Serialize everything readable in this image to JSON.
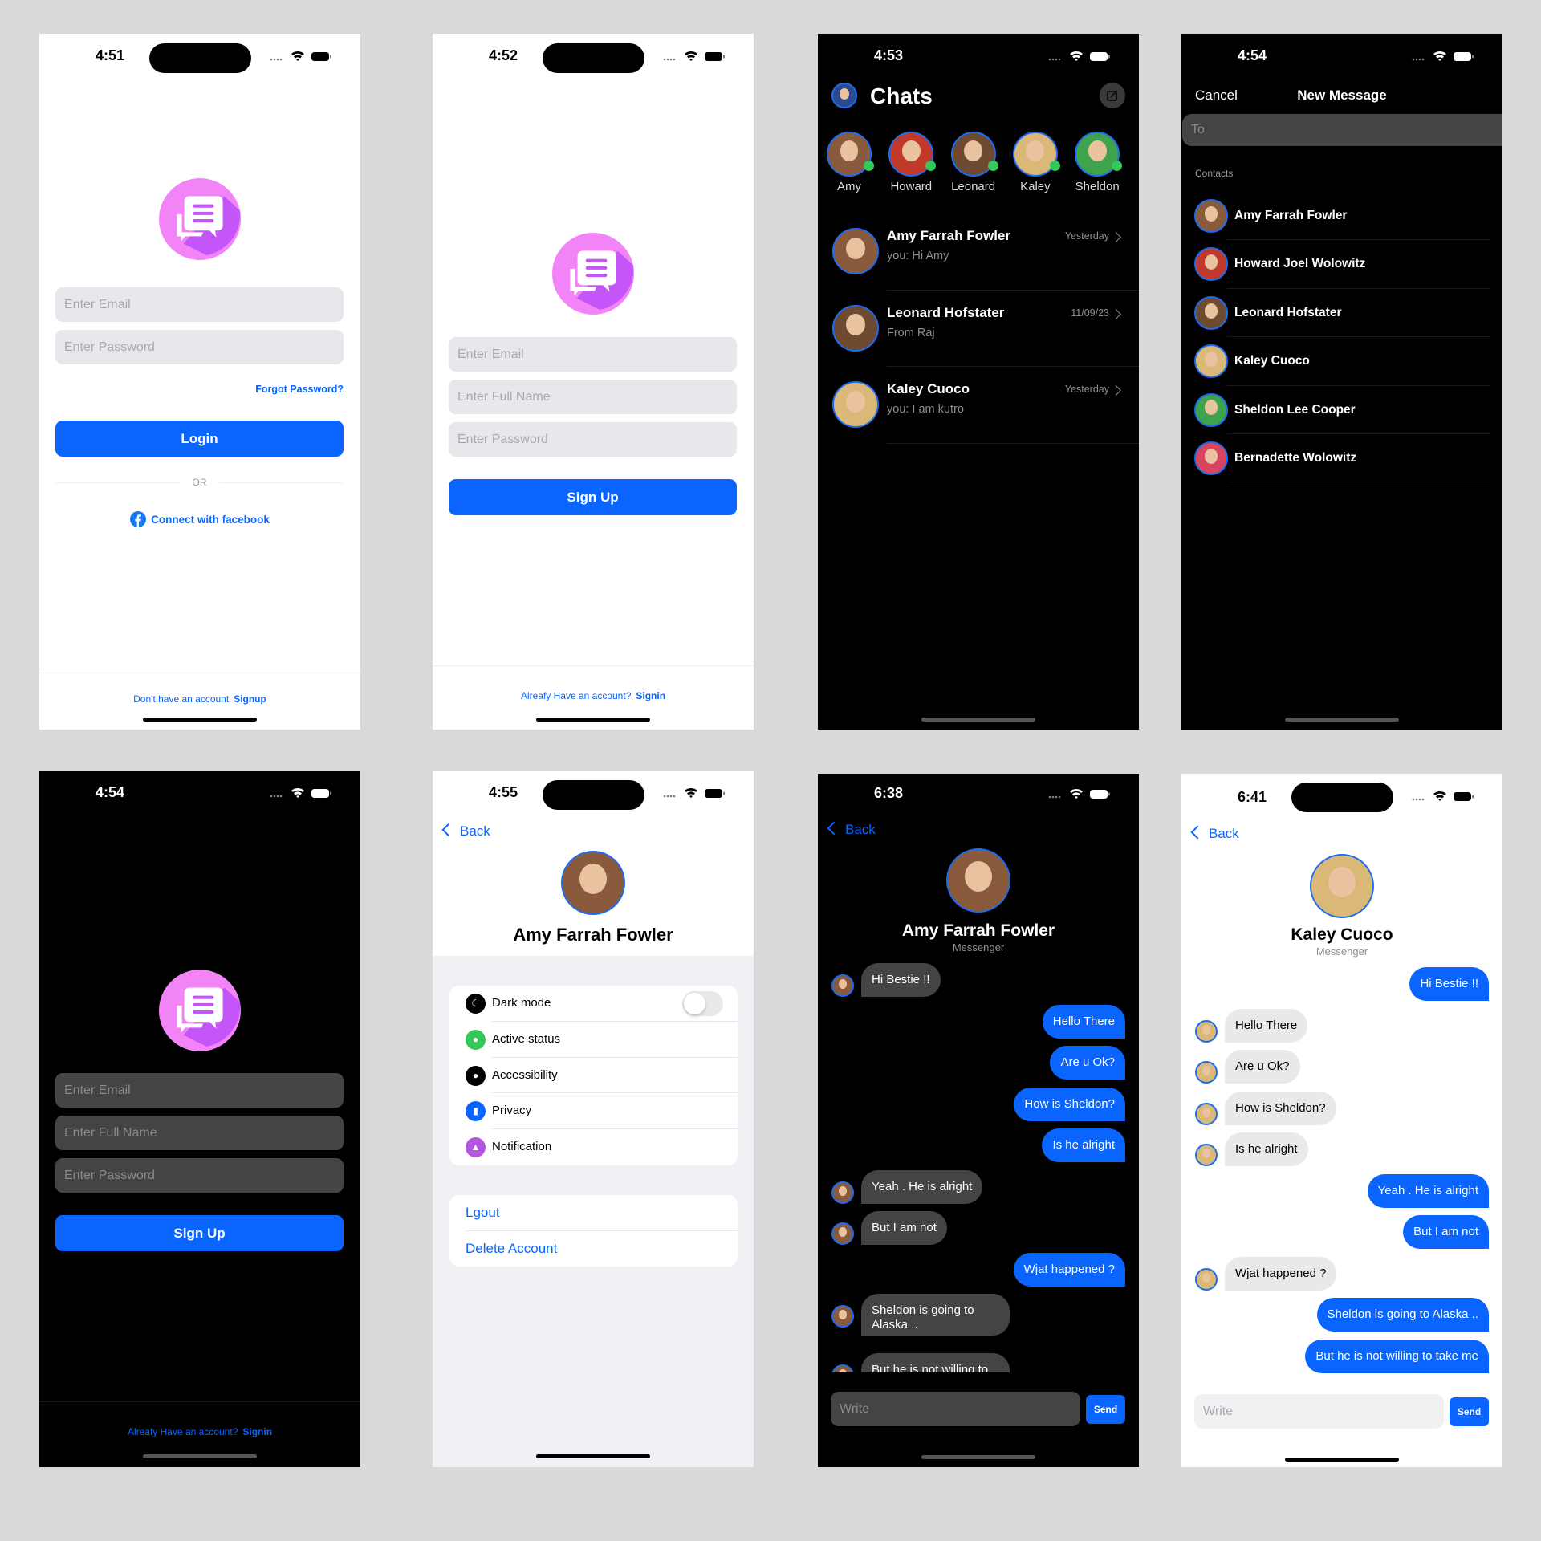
{
  "colors": {
    "accent": "#0a65ff",
    "online": "#34c759",
    "logo_pink": "#f384f8",
    "logo_purple": "#c455f9"
  },
  "login": {
    "time": "4:51",
    "email_placeholder": "Enter Email",
    "password_placeholder": "Enter Password",
    "forgot": "Forgot Password?",
    "login": "Login",
    "or": "OR",
    "facebook": "Connect with facebook",
    "footer_text": "Don't have an account",
    "footer_link": "Signup"
  },
  "signup_light": {
    "time": "4:52",
    "email_placeholder": "Enter Email",
    "fullname_placeholder": "Enter Full Name",
    "password_placeholder": "Enter Password",
    "signup": "Sign Up",
    "footer_text": "Alreafy Have an account?",
    "footer_link": "Signin"
  },
  "chats": {
    "time": "4:53",
    "title": "Chats",
    "stories": [
      {
        "name": "Amy",
        "color": "#8a5a3c",
        "online": true
      },
      {
        "name": "Howard",
        "color": "#c0392b",
        "online": true
      },
      {
        "name": "Leonard",
        "color": "#6e4a30",
        "online": true
      },
      {
        "name": "Kaley",
        "color": "#d9b878",
        "online": true
      },
      {
        "name": "Sheldon",
        "color": "#3fa34d",
        "online": true
      }
    ],
    "conversations": [
      {
        "name": "Amy Farrah Fowler",
        "preview": "you: Hi Amy",
        "date": "Yesterday",
        "color": "#8a5a3c"
      },
      {
        "name": "Leonard Hofstater",
        "preview": "From Raj",
        "date": "11/09/23",
        "color": "#6e4a30"
      },
      {
        "name": "Kaley Cuoco",
        "preview": "you: I am kutro",
        "date": "Yesterday",
        "color": "#d9b878"
      }
    ]
  },
  "new_message": {
    "time": "4:54",
    "cancel": "Cancel",
    "title": "New Message",
    "to_placeholder": "To",
    "contacts_label": "Contacts",
    "contacts": [
      {
        "name": "Amy Farrah Fowler",
        "color": "#8a5a3c"
      },
      {
        "name": "Howard Joel Wolowitz",
        "color": "#c0392b"
      },
      {
        "name": "Leonard Hofstater",
        "color": "#6e4a30"
      },
      {
        "name": "Kaley Cuoco",
        "color": "#d9b878"
      },
      {
        "name": "Sheldon Lee Cooper",
        "color": "#3fa34d"
      },
      {
        "name": "Bernadette Wolowitz",
        "color": "#d9455f"
      }
    ]
  },
  "signup_dark": {
    "time": "4:54",
    "email_placeholder": "Enter Email",
    "fullname_placeholder": "Enter Full Name",
    "password_placeholder": "Enter Password",
    "signup": "Sign Up",
    "footer_text": "Alreafy Have an account?",
    "footer_link": "Signin"
  },
  "profile": {
    "time": "4:55",
    "back": "Back",
    "name": "Amy Farrah Fowler",
    "dark_mode_on": false,
    "settings": [
      {
        "label": "Dark mode",
        "icon": "moon-icon",
        "color": "#000000"
      },
      {
        "label": "Active status",
        "icon": "chat-bubble-icon",
        "color": "#34c759"
      },
      {
        "label": "Accessibility",
        "icon": "person-icon",
        "color": "#000000"
      },
      {
        "label": "Privacy",
        "icon": "lock-icon",
        "color": "#0a65ff"
      },
      {
        "label": "Notification",
        "icon": "bell-icon",
        "color": "#b455e0"
      }
    ],
    "logout": "Lgout",
    "delete": "Delete Account"
  },
  "chat_dark": {
    "time": "6:38",
    "back": "Back",
    "name": "Amy Farrah Fowler",
    "subtitle": "Messenger",
    "input_placeholder": "Write",
    "send": "Send",
    "messages": [
      {
        "text": "Hi Bestie !!",
        "from": "them"
      },
      {
        "text": "Hello There",
        "from": "me"
      },
      {
        "text": "Are u Ok?",
        "from": "me"
      },
      {
        "text": "How is Sheldon?",
        "from": "me"
      },
      {
        "text": "Is he alright",
        "from": "me"
      },
      {
        "text": "Yeah . He is alright",
        "from": "them"
      },
      {
        "text": "But I am not",
        "from": "them"
      },
      {
        "text": "Wjat happened ?",
        "from": "me"
      },
      {
        "text": "Sheldon is going to Alaska ..",
        "from": "them"
      },
      {
        "text": "But he is not willing to take me",
        "from": "them"
      }
    ]
  },
  "chat_light": {
    "time": "6:41",
    "back": "Back",
    "name": "Kaley Cuoco",
    "subtitle": "Messenger",
    "input_placeholder": "Write",
    "send": "Send",
    "messages": [
      {
        "text": "Hi Bestie !!",
        "from": "me"
      },
      {
        "text": "Hello There",
        "from": "them"
      },
      {
        "text": "Are u Ok?",
        "from": "them"
      },
      {
        "text": "How is Sheldon?",
        "from": "them"
      },
      {
        "text": "Is he alright",
        "from": "them"
      },
      {
        "text": "Yeah . He is alright",
        "from": "me"
      },
      {
        "text": "But I am not",
        "from": "me"
      },
      {
        "text": "Wjat happened ?",
        "from": "them"
      },
      {
        "text": "Sheldon is going to Alaska ..",
        "from": "me"
      },
      {
        "text": "But he is not willing to take me",
        "from": "me"
      }
    ]
  }
}
